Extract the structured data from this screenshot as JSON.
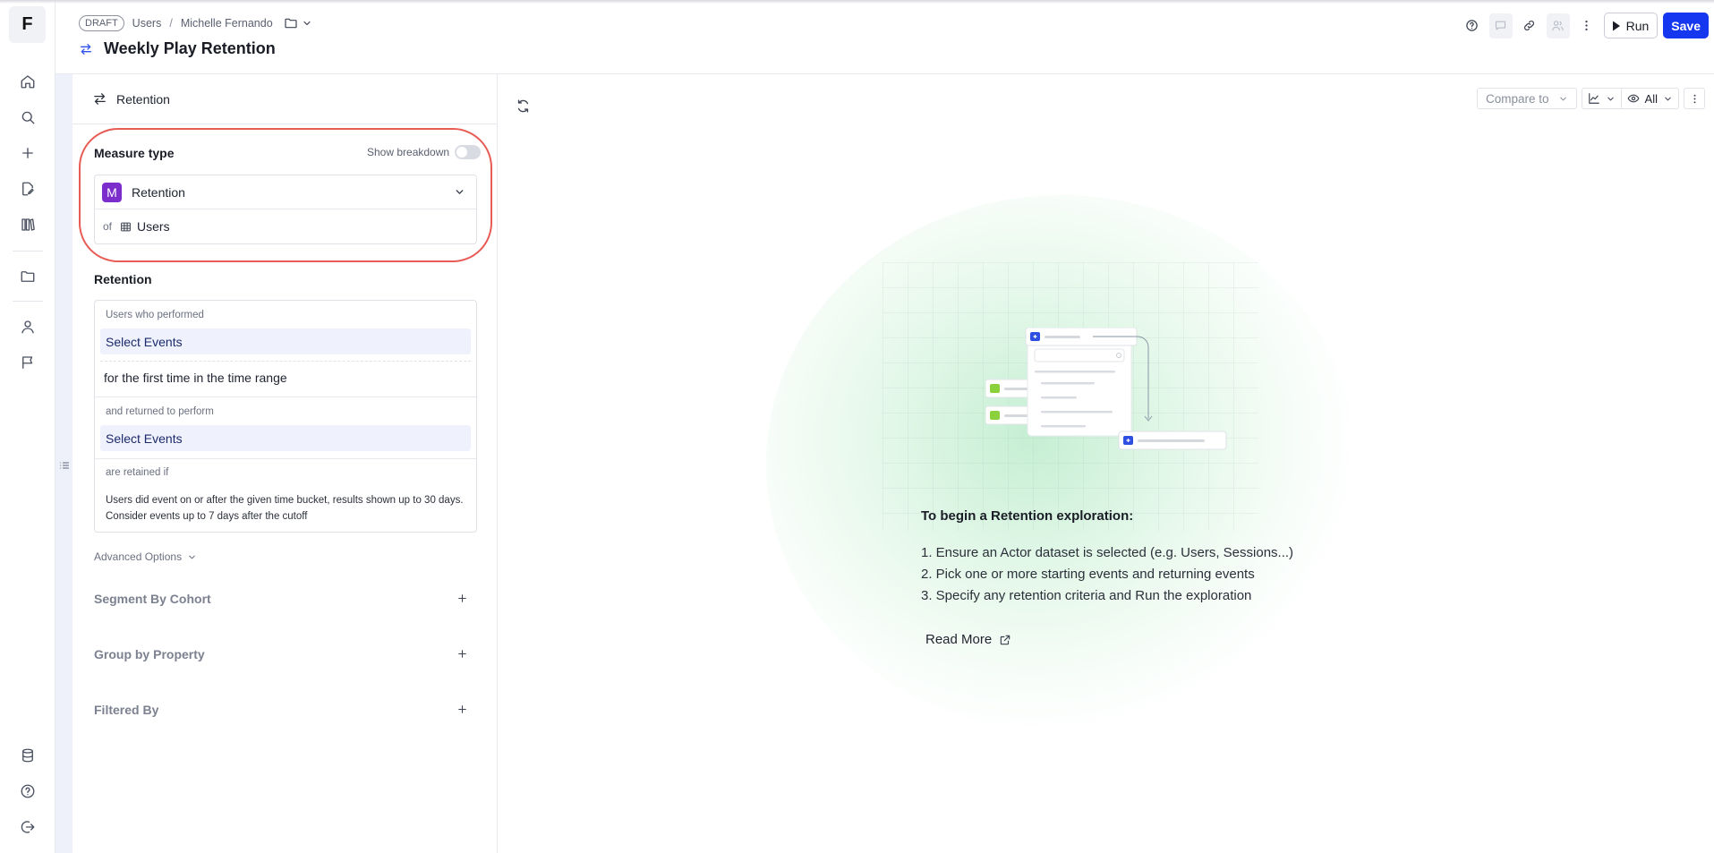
{
  "app": {
    "logo_letter": "F"
  },
  "breadcrumb": {
    "draft_badge": "DRAFT",
    "items": [
      "Users",
      "Michelle Fernando"
    ],
    "separator": "/"
  },
  "page": {
    "title": "Weekly Play Retention"
  },
  "header_actions": {
    "run_label": "Run",
    "save_label": "Save"
  },
  "colors": {
    "accent": "#1637f0",
    "measure_badge": "#7b2ecc",
    "highlight": "#e85c55",
    "select_bg": "#eff1fd"
  },
  "panel": {
    "header_label": "Retention",
    "measure": {
      "label": "Measure type",
      "breakdown_label": "Show breakdown",
      "breakdown_on": false,
      "badge_letter": "M",
      "selected": "Retention",
      "of_word": "of",
      "dataset": "Users"
    },
    "retention": {
      "label": "Retention",
      "performed_label": "Users who performed",
      "start_events_placeholder": "Select Events",
      "first_time_text": "for the first time in the time range",
      "returned_label": "and returned to perform",
      "return_events_placeholder": "Select Events",
      "retained_label": "are retained if",
      "retained_desc": "Users did event on or after the given time bucket, results shown up to 30 days. Consider events up to 7 days after the cutoff"
    },
    "advanced_label": "Advanced Options",
    "sections": [
      "Segment By Cohort",
      "Group by Property",
      "Filtered By"
    ]
  },
  "main": {
    "compare_label": "Compare to",
    "visibility_label": "All",
    "help_title": "To begin a Retention exploration:",
    "help_steps": [
      "1. Ensure an Actor dataset is selected (e.g. Users, Sessions...)",
      "2. Pick one or more starting events and returning events",
      "3. Specify any retention criteria and Run the exploration"
    ],
    "read_more": "Read More"
  }
}
